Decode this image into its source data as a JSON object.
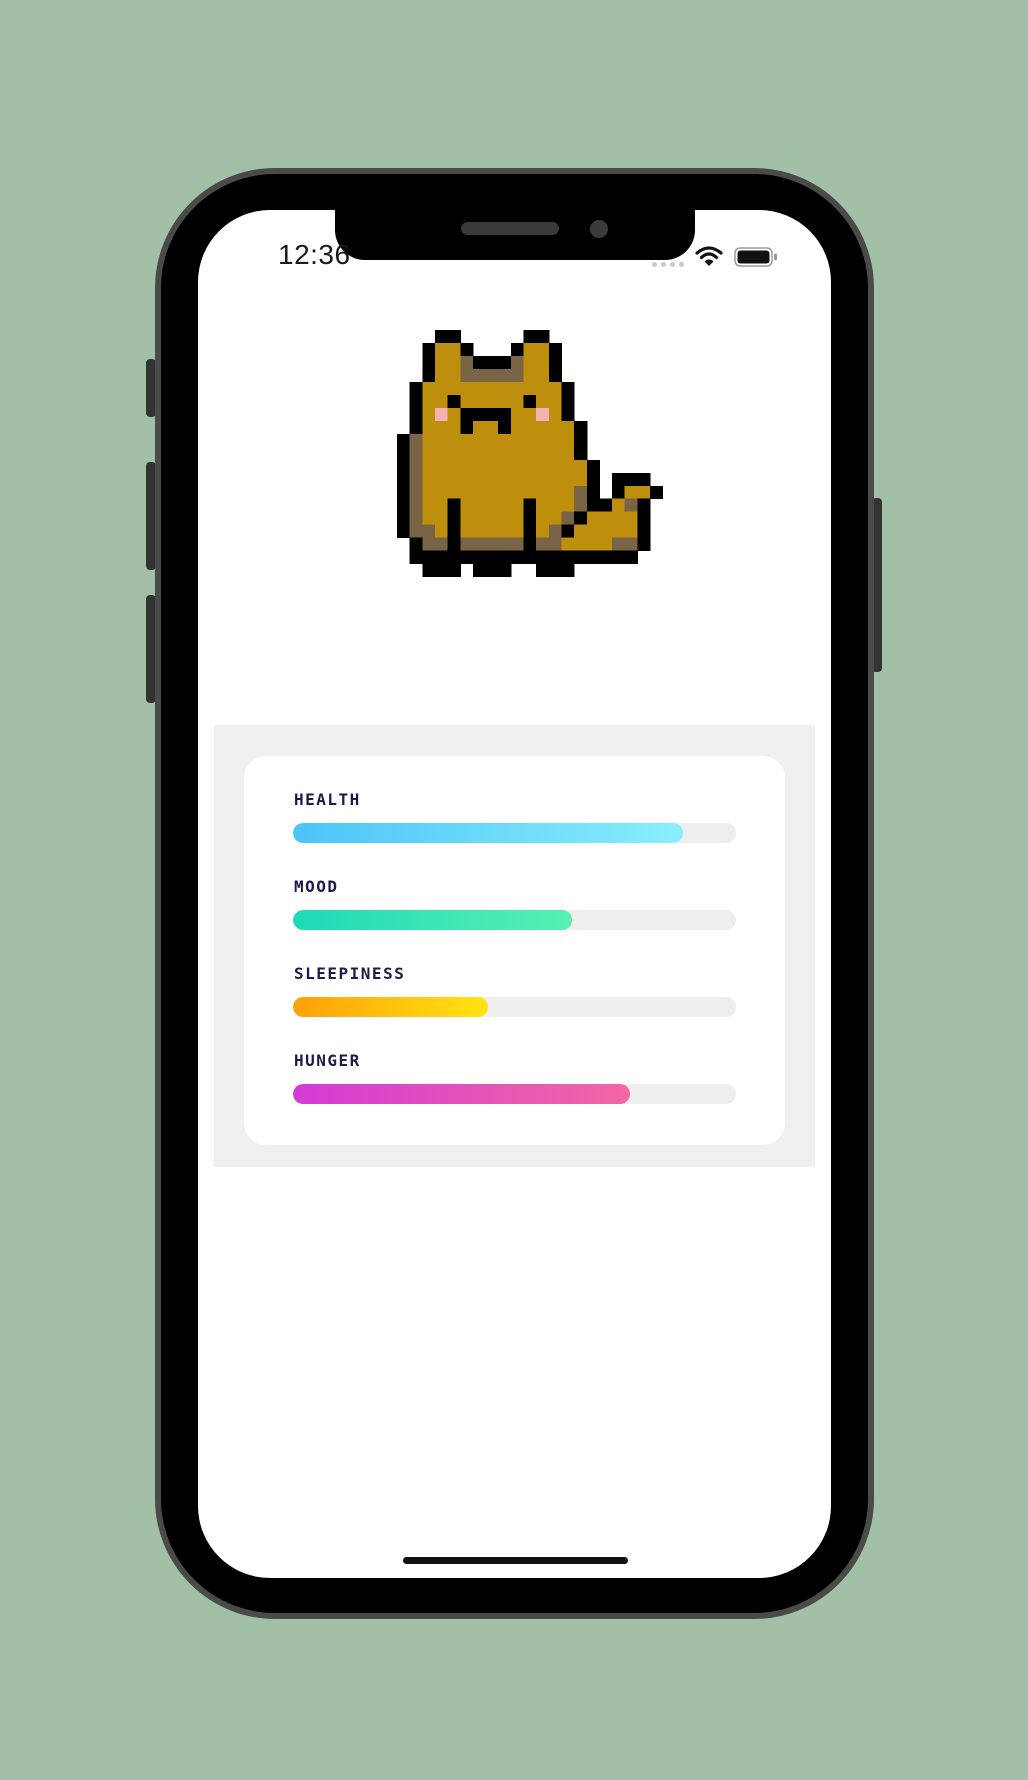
{
  "status_bar": {
    "time": "12:36",
    "icons": [
      "signal-dots-icon",
      "wifi-icon",
      "battery-icon"
    ]
  },
  "pet": {
    "image": "pixel-cat-icon",
    "fur_color": "#bd8f0c"
  },
  "stats": [
    {
      "label": "HEALTH",
      "level": 0.88,
      "colors": [
        "#4cc4f8",
        "#8aeefc"
      ]
    },
    {
      "label": "MOOD",
      "level": 0.63,
      "colors": [
        "#1fd9b7",
        "#58f0b2"
      ]
    },
    {
      "label": "SLEEPINESS",
      "level": 0.44,
      "colors": [
        "#ff9f0a",
        "#ffe410"
      ]
    },
    {
      "label": "HUNGER",
      "level": 0.76,
      "colors": [
        "#d53ad4",
        "#f466a4"
      ]
    }
  ],
  "colors": {
    "background": "#a1c0a5",
    "label_text": "#1d1b4b",
    "card_band": "#eff0f2"
  }
}
